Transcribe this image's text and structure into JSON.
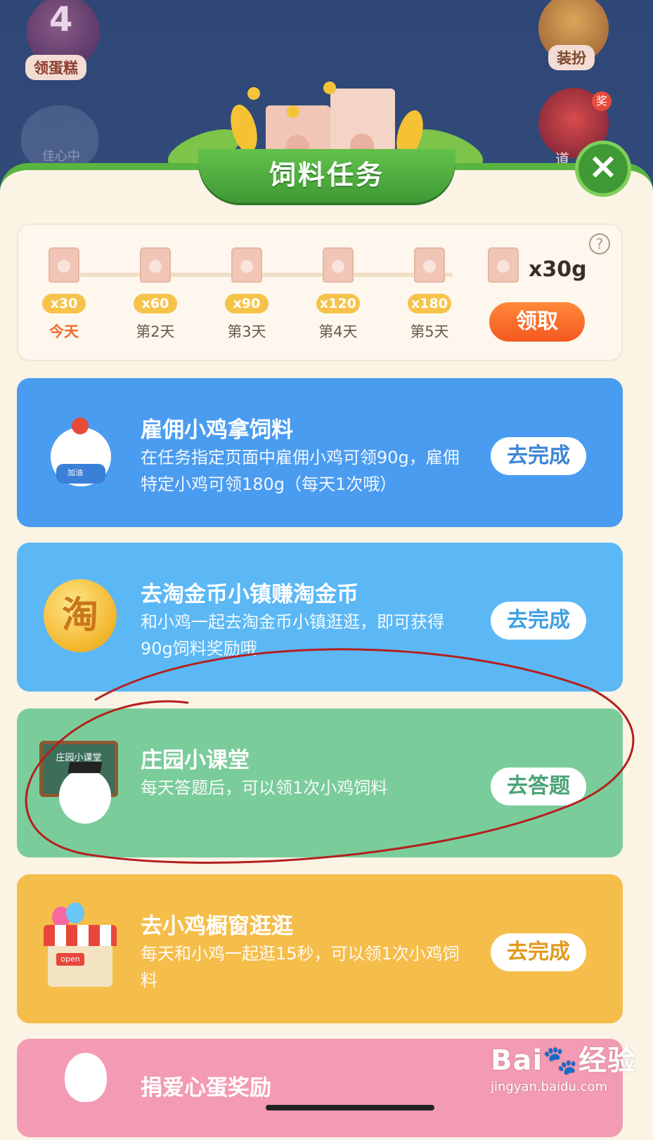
{
  "background": {
    "cake_badge": {
      "number": "4",
      "label": "领蛋糕"
    },
    "chick_status": "佳心中",
    "dress_up": {
      "label": "装扮"
    },
    "props": {
      "badge": "奖",
      "label": "道"
    }
  },
  "panel": {
    "title": "饲料任务",
    "close_glyph": "✕"
  },
  "checkin": {
    "days": [
      {
        "amount": "x30",
        "label": "今天"
      },
      {
        "amount": "x60",
        "label": "第2天"
      },
      {
        "amount": "x90",
        "label": "第3天"
      },
      {
        "amount": "x120",
        "label": "第4天"
      },
      {
        "amount": "x180",
        "label": "第5天"
      }
    ],
    "reward_amount": "x30g",
    "claim_label": "领取",
    "help_glyph": "?"
  },
  "tasks": [
    {
      "title": "雇佣小鸡拿饲料",
      "description": "在任务指定页面中雇佣小鸡可领90g，雇佣特定小鸡可领180g（每天1次哦）",
      "button": "去完成",
      "icon_label": "加油"
    },
    {
      "title": "去淘金币小镇赚淘金币",
      "description": "和小鸡一起去淘金币小镇逛逛，即可获得90g饲料奖励哦",
      "button": "去完成",
      "icon_label": "淘"
    },
    {
      "title": "庄园小课堂",
      "description": "每天答题后，可以领1次小鸡饲料",
      "button": "去答题",
      "icon_label": "庄园小课堂"
    },
    {
      "title": "去小鸡橱窗逛逛",
      "description": "每天和小鸡一起逛15秒，可以领1次小鸡饲料",
      "button": "去完成",
      "icon_label": "open"
    },
    {
      "title": "捐爱心蛋奖励"
    }
  ],
  "watermark": {
    "brand": "Bai🐾经验",
    "url": "jingyan.baidu.com"
  },
  "colors": {
    "panel_bg": "#fbf3e4",
    "title_green": "#3f9a35",
    "claim_orange": "#f4571f",
    "task_blue": "#4a9cf0",
    "task_sky": "#5bb8f5",
    "task_green": "#7bcc9b",
    "task_yellow": "#f5bd4a",
    "task_pink": "#f39bb3",
    "annotation_red": "#b3201e"
  }
}
